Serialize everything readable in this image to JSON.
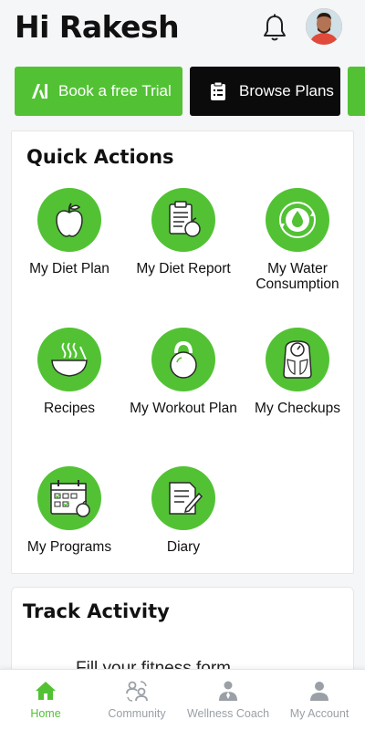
{
  "header": {
    "greeting": "Hi Rakesh"
  },
  "promos": {
    "trial_label": "Book a free Trial",
    "plans_label": "Browse Plans"
  },
  "quick_actions": {
    "title": "Quick Actions",
    "items": [
      {
        "label": "My Diet Plan",
        "icon": "apple-icon"
      },
      {
        "label": "My Diet Report",
        "icon": "clipboard-apple-icon"
      },
      {
        "label": "My Water Consumption",
        "icon": "water-drop-cycle-icon"
      },
      {
        "label": "Recipes",
        "icon": "steaming-bowl-icon"
      },
      {
        "label": "My Workout Plan",
        "icon": "kettlebell-icon"
      },
      {
        "label": "My Checkups",
        "icon": "weighing-scale-icon"
      },
      {
        "label": "My Programs",
        "icon": "calendar-check-icon"
      },
      {
        "label": "Diary",
        "icon": "notebook-pen-icon"
      }
    ]
  },
  "track_activity": {
    "title": "Track Activity",
    "text": "Fill your fitness form"
  },
  "bottom_nav": {
    "items": [
      {
        "label": "Home",
        "icon": "home-icon",
        "active": true
      },
      {
        "label": "Community",
        "icon": "community-icon",
        "active": false
      },
      {
        "label": "Wellness Coach",
        "icon": "coach-icon",
        "active": false
      },
      {
        "label": "My Account",
        "icon": "account-icon",
        "active": false
      }
    ]
  },
  "colors": {
    "accent": "#52c234",
    "dark_button": "#0b0b0b",
    "nav_inactive": "#9aa0a6"
  }
}
